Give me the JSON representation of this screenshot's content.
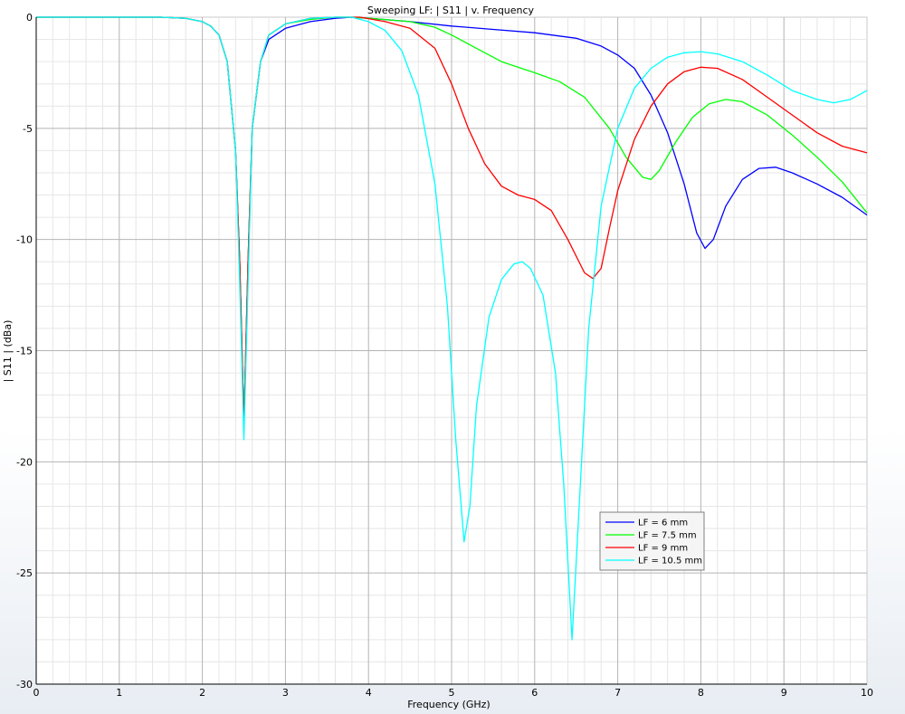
{
  "chart_data": {
    "type": "line",
    "title": "Sweeping LF: | S11 | v. Frequency",
    "xlabel": "Frequency (GHz)",
    "ylabel": "| S11 | (dBa)",
    "xlim": [
      0,
      10
    ],
    "ylim": [
      -30,
      0
    ],
    "xticks": [
      0,
      1,
      2,
      3,
      4,
      5,
      6,
      7,
      8,
      9,
      10
    ],
    "yticks": [
      0,
      -5,
      -10,
      -15,
      -20,
      -25,
      -30
    ],
    "grid": true,
    "legend_position": "bottom-right",
    "series": [
      {
        "name": "LF = 6 mm",
        "color": "#0000ff",
        "points": [
          [
            0,
            0
          ],
          [
            1,
            0
          ],
          [
            1.5,
            0
          ],
          [
            1.8,
            -0.05
          ],
          [
            2.0,
            -0.2
          ],
          [
            2.1,
            -0.4
          ],
          [
            2.2,
            -0.8
          ],
          [
            2.3,
            -2.0
          ],
          [
            2.4,
            -6.0
          ],
          [
            2.45,
            -11.0
          ],
          [
            2.5,
            -18.2
          ],
          [
            2.55,
            -11.0
          ],
          [
            2.6,
            -5.0
          ],
          [
            2.7,
            -2.0
          ],
          [
            2.8,
            -1.0
          ],
          [
            3.0,
            -0.5
          ],
          [
            3.3,
            -0.2
          ],
          [
            3.6,
            -0.05
          ],
          [
            3.8,
            0
          ],
          [
            4.0,
            -0.05
          ],
          [
            4.5,
            -0.2
          ],
          [
            5.0,
            -0.4
          ],
          [
            5.5,
            -0.55
          ],
          [
            6.0,
            -0.7
          ],
          [
            6.5,
            -0.95
          ],
          [
            6.8,
            -1.3
          ],
          [
            7.0,
            -1.7
          ],
          [
            7.2,
            -2.3
          ],
          [
            7.4,
            -3.5
          ],
          [
            7.6,
            -5.2
          ],
          [
            7.8,
            -7.5
          ],
          [
            7.95,
            -9.7
          ],
          [
            8.05,
            -10.4
          ],
          [
            8.15,
            -10.0
          ],
          [
            8.3,
            -8.5
          ],
          [
            8.5,
            -7.3
          ],
          [
            8.7,
            -6.8
          ],
          [
            8.9,
            -6.75
          ],
          [
            9.1,
            -7.0
          ],
          [
            9.4,
            -7.5
          ],
          [
            9.7,
            -8.1
          ],
          [
            10.0,
            -8.9
          ]
        ]
      },
      {
        "name": "LF = 7.5 mm",
        "color": "#00ff00",
        "points": [
          [
            0,
            0
          ],
          [
            1,
            0
          ],
          [
            1.5,
            0
          ],
          [
            1.8,
            -0.05
          ],
          [
            2.0,
            -0.2
          ],
          [
            2.1,
            -0.4
          ],
          [
            2.2,
            -0.8
          ],
          [
            2.3,
            -2.0
          ],
          [
            2.4,
            -6.0
          ],
          [
            2.45,
            -11.0
          ],
          [
            2.5,
            -18.3
          ],
          [
            2.55,
            -11.0
          ],
          [
            2.6,
            -5.0
          ],
          [
            2.7,
            -2.0
          ],
          [
            2.8,
            -0.8
          ],
          [
            3.0,
            -0.3
          ],
          [
            3.3,
            -0.1
          ],
          [
            3.6,
            0
          ],
          [
            3.8,
            0
          ],
          [
            4.0,
            -0.05
          ],
          [
            4.5,
            -0.2
          ],
          [
            4.8,
            -0.45
          ],
          [
            5.0,
            -0.8
          ],
          [
            5.3,
            -1.4
          ],
          [
            5.6,
            -2.0
          ],
          [
            6.0,
            -2.5
          ],
          [
            6.3,
            -2.9
          ],
          [
            6.6,
            -3.6
          ],
          [
            6.9,
            -5.0
          ],
          [
            7.1,
            -6.3
          ],
          [
            7.3,
            -7.2
          ],
          [
            7.4,
            -7.3
          ],
          [
            7.5,
            -6.9
          ],
          [
            7.7,
            -5.6
          ],
          [
            7.9,
            -4.5
          ],
          [
            8.1,
            -3.9
          ],
          [
            8.3,
            -3.7
          ],
          [
            8.5,
            -3.8
          ],
          [
            8.8,
            -4.4
          ],
          [
            9.1,
            -5.3
          ],
          [
            9.4,
            -6.3
          ],
          [
            9.7,
            -7.4
          ],
          [
            10.0,
            -8.8
          ]
        ]
      },
      {
        "name": "LF = 9 mm",
        "color": "#ff0000",
        "points": [
          [
            0,
            0
          ],
          [
            1,
            0
          ],
          [
            1.5,
            0
          ],
          [
            1.8,
            -0.05
          ],
          [
            2.0,
            -0.2
          ],
          [
            2.1,
            -0.4
          ],
          [
            2.2,
            -0.8
          ],
          [
            2.3,
            -2.0
          ],
          [
            2.4,
            -6.0
          ],
          [
            2.45,
            -11.0
          ],
          [
            2.5,
            -18.4
          ],
          [
            2.55,
            -11.0
          ],
          [
            2.6,
            -5.0
          ],
          [
            2.7,
            -2.0
          ],
          [
            2.8,
            -0.8
          ],
          [
            3.0,
            -0.3
          ],
          [
            3.3,
            -0.05
          ],
          [
            3.6,
            0
          ],
          [
            3.9,
            0
          ],
          [
            4.2,
            -0.2
          ],
          [
            4.5,
            -0.5
          ],
          [
            4.8,
            -1.4
          ],
          [
            5.0,
            -3.0
          ],
          [
            5.2,
            -5.0
          ],
          [
            5.4,
            -6.6
          ],
          [
            5.6,
            -7.6
          ],
          [
            5.8,
            -8.0
          ],
          [
            6.0,
            -8.2
          ],
          [
            6.2,
            -8.7
          ],
          [
            6.4,
            -10.0
          ],
          [
            6.6,
            -11.5
          ],
          [
            6.7,
            -11.75
          ],
          [
            6.8,
            -11.3
          ],
          [
            6.9,
            -9.5
          ],
          [
            7.0,
            -7.8
          ],
          [
            7.2,
            -5.5
          ],
          [
            7.4,
            -4.0
          ],
          [
            7.6,
            -3.0
          ],
          [
            7.8,
            -2.45
          ],
          [
            8.0,
            -2.25
          ],
          [
            8.2,
            -2.3
          ],
          [
            8.5,
            -2.8
          ],
          [
            8.8,
            -3.6
          ],
          [
            9.1,
            -4.4
          ],
          [
            9.4,
            -5.2
          ],
          [
            9.7,
            -5.8
          ],
          [
            10.0,
            -6.1
          ]
        ]
      },
      {
        "name": "LF = 10.5 mm",
        "color": "#00ffff",
        "points": [
          [
            0,
            0
          ],
          [
            1,
            0
          ],
          [
            1.5,
            0
          ],
          [
            1.8,
            -0.05
          ],
          [
            2.0,
            -0.2
          ],
          [
            2.1,
            -0.4
          ],
          [
            2.2,
            -0.8
          ],
          [
            2.3,
            -2.0
          ],
          [
            2.4,
            -6.0
          ],
          [
            2.45,
            -12.0
          ],
          [
            2.5,
            -19.0
          ],
          [
            2.55,
            -12.0
          ],
          [
            2.6,
            -5.0
          ],
          [
            2.7,
            -2.0
          ],
          [
            2.8,
            -0.8
          ],
          [
            3.0,
            -0.3
          ],
          [
            3.3,
            -0.05
          ],
          [
            3.6,
            0
          ],
          [
            3.8,
            0
          ],
          [
            4.0,
            -0.2
          ],
          [
            4.2,
            -0.6
          ],
          [
            4.4,
            -1.5
          ],
          [
            4.6,
            -3.5
          ],
          [
            4.8,
            -7.5
          ],
          [
            4.95,
            -13.0
          ],
          [
            5.05,
            -19.0
          ],
          [
            5.15,
            -23.6
          ],
          [
            5.22,
            -22.0
          ],
          [
            5.3,
            -17.5
          ],
          [
            5.45,
            -13.5
          ],
          [
            5.6,
            -11.8
          ],
          [
            5.75,
            -11.1
          ],
          [
            5.85,
            -11.0
          ],
          [
            5.95,
            -11.3
          ],
          [
            6.1,
            -12.5
          ],
          [
            6.25,
            -16.0
          ],
          [
            6.35,
            -21.0
          ],
          [
            6.45,
            -28.0
          ],
          [
            6.55,
            -21.0
          ],
          [
            6.65,
            -14.0
          ],
          [
            6.8,
            -8.5
          ],
          [
            7.0,
            -5.0
          ],
          [
            7.2,
            -3.2
          ],
          [
            7.4,
            -2.3
          ],
          [
            7.6,
            -1.8
          ],
          [
            7.8,
            -1.6
          ],
          [
            8.0,
            -1.55
          ],
          [
            8.2,
            -1.65
          ],
          [
            8.5,
            -2.0
          ],
          [
            8.8,
            -2.6
          ],
          [
            9.1,
            -3.3
          ],
          [
            9.4,
            -3.7
          ],
          [
            9.6,
            -3.85
          ],
          [
            9.8,
            -3.7
          ],
          [
            10.0,
            -3.3
          ]
        ]
      }
    ]
  }
}
